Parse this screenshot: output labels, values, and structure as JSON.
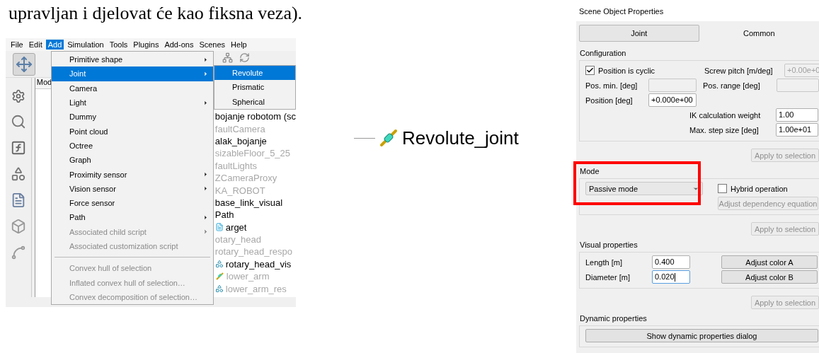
{
  "document": {
    "text": "upravljan i djelovat će kao fiksna veza)."
  },
  "menu_bar": [
    {
      "label": "File",
      "selected": false
    },
    {
      "label": "Edit",
      "selected": false
    },
    {
      "label": "Add",
      "selected": true
    },
    {
      "label": "Simulation",
      "selected": false
    },
    {
      "label": "Tools",
      "selected": false
    },
    {
      "label": "Plugins",
      "selected": false
    },
    {
      "label": "Add-ons",
      "selected": false
    },
    {
      "label": "Scenes",
      "selected": false
    },
    {
      "label": "Help",
      "selected": false
    }
  ],
  "tree": {
    "header": "Mod",
    "items": [
      {
        "label": "bojanje robotom (sc",
        "dimmed": false,
        "kind": "plain"
      },
      {
        "label": "faultCamera",
        "dimmed": true,
        "kind": "plain"
      },
      {
        "label": "alak_bojanje",
        "dimmed": false,
        "kind": "plain"
      },
      {
        "label": "sizableFloor_5_25",
        "dimmed": true,
        "kind": "plain"
      },
      {
        "label": "faultLights",
        "dimmed": true,
        "kind": "plain"
      },
      {
        "label": "ZCameraProxy",
        "dimmed": true,
        "kind": "plain"
      },
      {
        "label": "KA_ROBOT",
        "dimmed": true,
        "kind": "plain"
      },
      {
        "label": "base_link_visual",
        "dimmed": false,
        "kind": "plain"
      },
      {
        "label": "Path",
        "dimmed": false,
        "kind": "plain"
      },
      {
        "label": "arget",
        "dimmed": false,
        "kind": "script"
      },
      {
        "label": "otary_head",
        "dimmed": true,
        "kind": "plain"
      },
      {
        "label": "rotary_head_respo",
        "dimmed": true,
        "kind": "plain"
      },
      {
        "label": "rotary_head_vis",
        "dimmed": false,
        "kind": "shape"
      },
      {
        "label": "lower_arm",
        "dimmed": true,
        "kind": "joint"
      },
      {
        "label": "lower_arm_res",
        "dimmed": true,
        "kind": "shape"
      }
    ]
  },
  "add_menu": [
    {
      "kind": "item",
      "label": "Primitive shape",
      "submenu": true,
      "selected": false,
      "disabled": false
    },
    {
      "kind": "item",
      "label": "Joint",
      "submenu": true,
      "selected": true,
      "disabled": false
    },
    {
      "kind": "item",
      "label": "Camera",
      "submenu": false,
      "selected": false,
      "disabled": false
    },
    {
      "kind": "item",
      "label": "Light",
      "submenu": true,
      "selected": false,
      "disabled": false
    },
    {
      "kind": "item",
      "label": "Dummy",
      "submenu": false,
      "selected": false,
      "disabled": false
    },
    {
      "kind": "item",
      "label": "Point cloud",
      "submenu": false,
      "selected": false,
      "disabled": false
    },
    {
      "kind": "item",
      "label": "Octree",
      "submenu": false,
      "selected": false,
      "disabled": false
    },
    {
      "kind": "item",
      "label": "Graph",
      "submenu": false,
      "selected": false,
      "disabled": false
    },
    {
      "kind": "item",
      "label": "Proximity sensor",
      "submenu": true,
      "selected": false,
      "disabled": false
    },
    {
      "kind": "item",
      "label": "Vision sensor",
      "submenu": true,
      "selected": false,
      "disabled": false
    },
    {
      "kind": "item",
      "label": "Force sensor",
      "submenu": false,
      "selected": false,
      "disabled": false
    },
    {
      "kind": "item",
      "label": "Path",
      "submenu": true,
      "selected": false,
      "disabled": false
    },
    {
      "kind": "item",
      "label": "Associated child script",
      "submenu": true,
      "selected": false,
      "disabled": true
    },
    {
      "kind": "item",
      "label": "Associated customization script",
      "submenu": false,
      "selected": false,
      "disabled": true
    },
    {
      "kind": "separator"
    },
    {
      "kind": "item",
      "label": "Convex hull of selection",
      "submenu": false,
      "selected": false,
      "disabled": true
    },
    {
      "kind": "item",
      "label": "Inflated convex hull of selection…",
      "submenu": false,
      "selected": false,
      "disabled": true
    },
    {
      "kind": "item",
      "label": "Convex decomposition of selection…",
      "submenu": false,
      "selected": false,
      "disabled": true
    }
  ],
  "joint_submenu": [
    {
      "label": "Revolute",
      "selected": true
    },
    {
      "label": "Prismatic",
      "selected": false
    },
    {
      "label": "Spherical",
      "selected": false
    }
  ],
  "joint_label": {
    "text": "Revolute_joint"
  },
  "properties": {
    "title": "Scene Object Properties",
    "tabs": [
      {
        "label": "Joint",
        "selected": true
      },
      {
        "label": "Common",
        "selected": false
      }
    ],
    "configuration": {
      "label": "Configuration",
      "cyclic": {
        "label": "Position is cyclic",
        "checked": true
      },
      "screw_pitch": {
        "label": "Screw pitch [m/deg]",
        "value": "+0.00e+0",
        "disabled": true
      },
      "pos_min": {
        "label": "Pos. min. [deg]",
        "disabled": true
      },
      "pos_range": {
        "label": "Pos. range [deg]",
        "disabled": true
      },
      "position": {
        "label": "Position [deg]",
        "value": "+0.000e+00",
        "disabled": false
      },
      "ik_weight": {
        "label": "IK calculation weight",
        "value": "1.00",
        "disabled": false
      },
      "max_step": {
        "label": "Max. step size [deg]",
        "value": "1.00e+01",
        "disabled": false
      },
      "apply": {
        "label": "Apply to selection",
        "disabled": true
      }
    },
    "mode": {
      "label": "Mode",
      "highlighted": true,
      "dropdown": "Passive mode",
      "hybrid": {
        "label": "Hybrid operation",
        "checked": false
      },
      "dependency": {
        "label": "Adjust dependency equation",
        "disabled": true
      },
      "apply": {
        "label": "Apply to selection",
        "disabled": true
      }
    },
    "visual": {
      "label": "Visual properties",
      "length": {
        "label": "Length [m]",
        "value": "0.400",
        "focused": false
      },
      "diameter": {
        "label": "Diameter [m]",
        "value": "0.020",
        "focused": true
      },
      "color_a": "Adjust color A",
      "color_b": "Adjust color B",
      "apply": {
        "label": "Apply to selection",
        "disabled": true
      }
    },
    "dynamic": {
      "label": "Dynamic properties",
      "button": "Show dynamic properties dialog"
    }
  }
}
